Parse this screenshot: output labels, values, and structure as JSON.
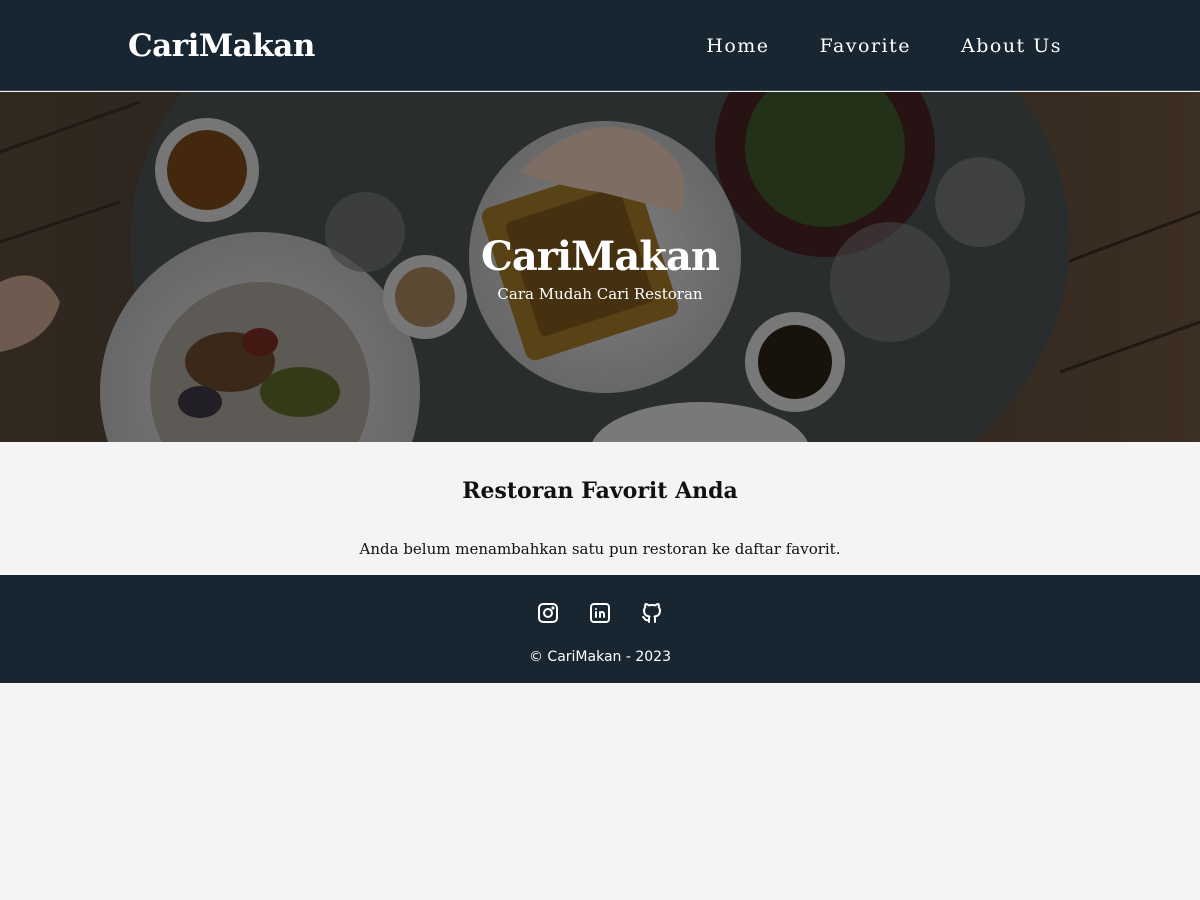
{
  "header": {
    "brand": "CariMakan",
    "nav": [
      {
        "label": "Home"
      },
      {
        "label": "Favorite"
      },
      {
        "label": "About Us"
      }
    ]
  },
  "hero": {
    "title": "CariMakan",
    "subtitle": "Cara Mudah Cari Restoran"
  },
  "main": {
    "heading": "Restoran Favorit Anda",
    "empty_message": "Anda belum menambahkan satu pun restoran ke daftar favorit."
  },
  "footer": {
    "social": [
      {
        "icon": "instagram-icon"
      },
      {
        "icon": "linkedin-icon"
      },
      {
        "icon": "github-icon"
      }
    ],
    "copyright": "© CariMakan - 2023"
  },
  "colors": {
    "navbar_bg": "#172630",
    "page_bg": "#f4f4f4",
    "text_light": "#ffffff",
    "text_dark": "#111111"
  }
}
